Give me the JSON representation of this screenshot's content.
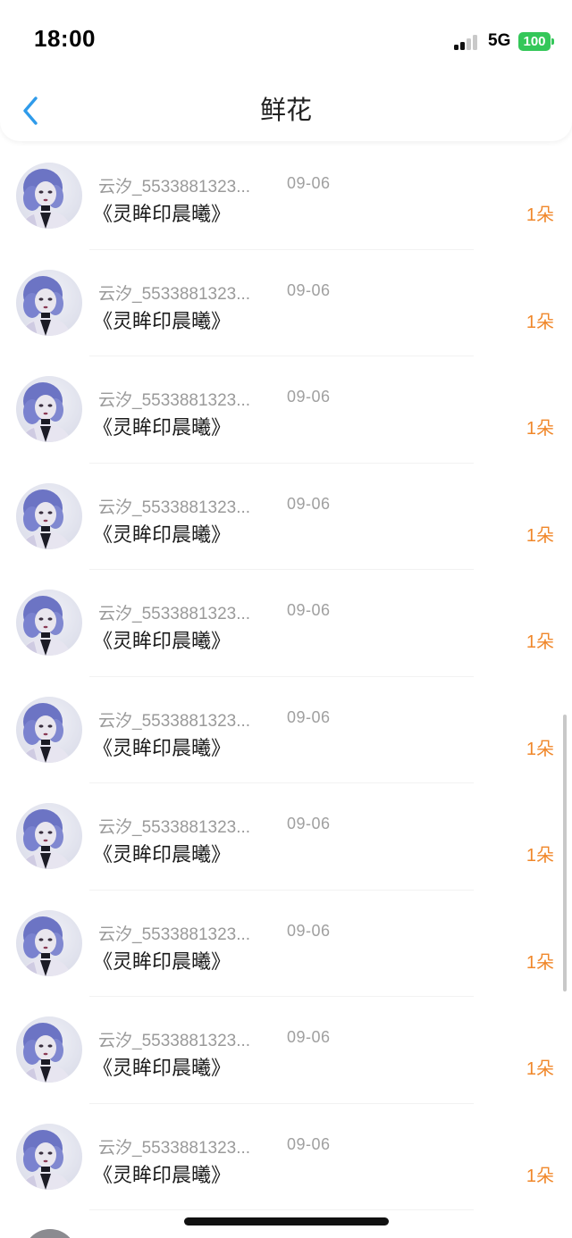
{
  "status_bar": {
    "time": "18:00",
    "network": "5G",
    "battery": "100"
  },
  "header": {
    "title": "鲜花",
    "back_icon": "chevron-left-icon"
  },
  "colors": {
    "accent_blue": "#2f9bea",
    "count_orange": "#f0872a",
    "battery_green": "#34c759"
  },
  "items": [
    {
      "username": "云汐_5533881323...",
      "date": "09-06",
      "title": "《灵眸印晨曦》",
      "count": "1朵"
    },
    {
      "username": "云汐_5533881323...",
      "date": "09-06",
      "title": "《灵眸印晨曦》",
      "count": "1朵"
    },
    {
      "username": "云汐_5533881323...",
      "date": "09-06",
      "title": "《灵眸印晨曦》",
      "count": "1朵"
    },
    {
      "username": "云汐_5533881323...",
      "date": "09-06",
      "title": "《灵眸印晨曦》",
      "count": "1朵"
    },
    {
      "username": "云汐_5533881323...",
      "date": "09-06",
      "title": "《灵眸印晨曦》",
      "count": "1朵"
    },
    {
      "username": "云汐_5533881323...",
      "date": "09-06",
      "title": "《灵眸印晨曦》",
      "count": "1朵"
    },
    {
      "username": "云汐_5533881323...",
      "date": "09-06",
      "title": "《灵眸印晨曦》",
      "count": "1朵"
    },
    {
      "username": "云汐_5533881323...",
      "date": "09-06",
      "title": "《灵眸印晨曦》",
      "count": "1朵"
    },
    {
      "username": "云汐_5533881323...",
      "date": "09-06",
      "title": "《灵眸印晨曦》",
      "count": "1朵"
    },
    {
      "username": "云汐_5533881323...",
      "date": "09-06",
      "title": "《灵眸印晨曦》",
      "count": "1朵"
    }
  ]
}
